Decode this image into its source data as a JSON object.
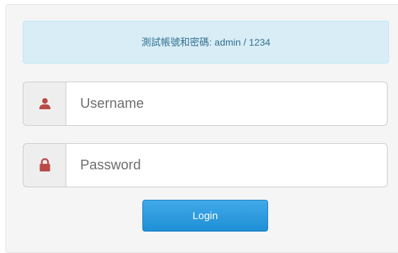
{
  "alert": {
    "text": "測試帳號和密碼: admin / 1234"
  },
  "username": {
    "icon": "user-icon",
    "placeholder": "Username",
    "value": ""
  },
  "password": {
    "icon": "lock-icon",
    "placeholder": "Password",
    "value": ""
  },
  "login": {
    "label": "Login"
  },
  "colors": {
    "icon": "#b94a48",
    "alert_bg": "#d9edf7",
    "alert_text": "#31708f",
    "button": "#2d9be0"
  }
}
